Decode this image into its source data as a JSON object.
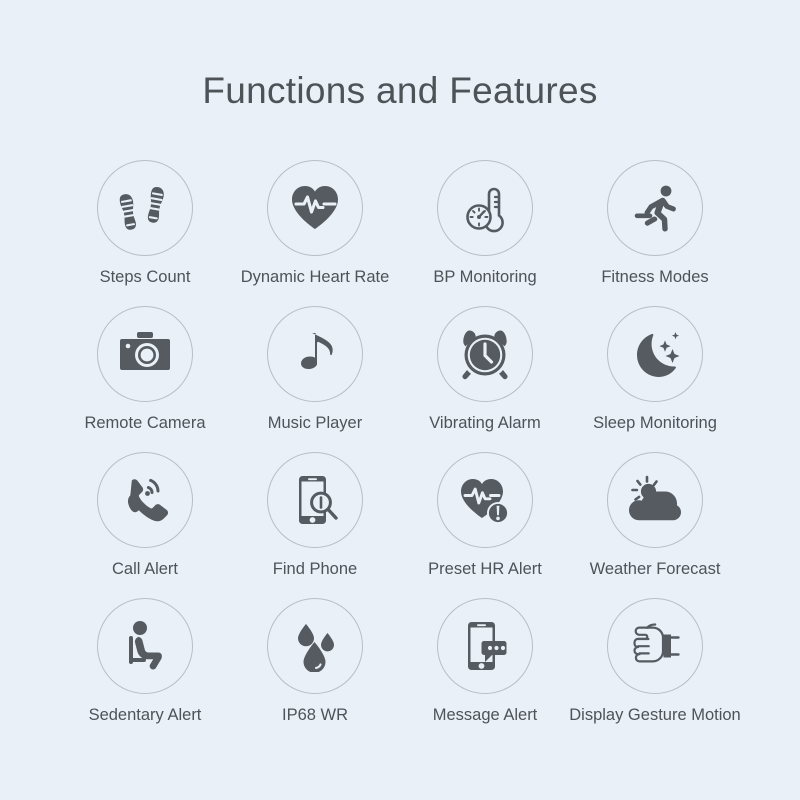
{
  "page": {
    "title": "Functions and Features",
    "background_color": "#eaf0f8",
    "text_color": "#4e5358",
    "icon_color": "#555b60",
    "circle_border_color": "#b9bec4"
  },
  "features": [
    {
      "label": "Steps Count",
      "icon": "footprints-icon"
    },
    {
      "label": "Dynamic Heart Rate",
      "icon": "heart-pulse-icon"
    },
    {
      "label": "BP Monitoring",
      "icon": "thermometer-gauge-icon"
    },
    {
      "label": "Fitness Modes",
      "icon": "running-person-icon"
    },
    {
      "label": "Remote Camera",
      "icon": "camera-icon"
    },
    {
      "label": "Music Player",
      "icon": "music-note-icon"
    },
    {
      "label": "Vibrating Alarm",
      "icon": "alarm-clock-icon"
    },
    {
      "label": "Sleep Monitoring",
      "icon": "moon-stars-icon"
    },
    {
      "label": "Call Alert",
      "icon": "phone-handset-ring-icon"
    },
    {
      "label": "Find Phone",
      "icon": "phone-magnifier-icon"
    },
    {
      "label": "Preset HR Alert",
      "icon": "heart-pulse-warning-icon"
    },
    {
      "label": "Weather Forecast",
      "icon": "sun-cloud-icon"
    },
    {
      "label": "Sedentary Alert",
      "icon": "sitting-person-icon"
    },
    {
      "label": "IP68 WR",
      "icon": "water-drops-icon"
    },
    {
      "label": "Message Alert",
      "icon": "phone-message-icon"
    },
    {
      "label": "Display Gesture Motion",
      "icon": "fist-wristband-icon"
    }
  ]
}
